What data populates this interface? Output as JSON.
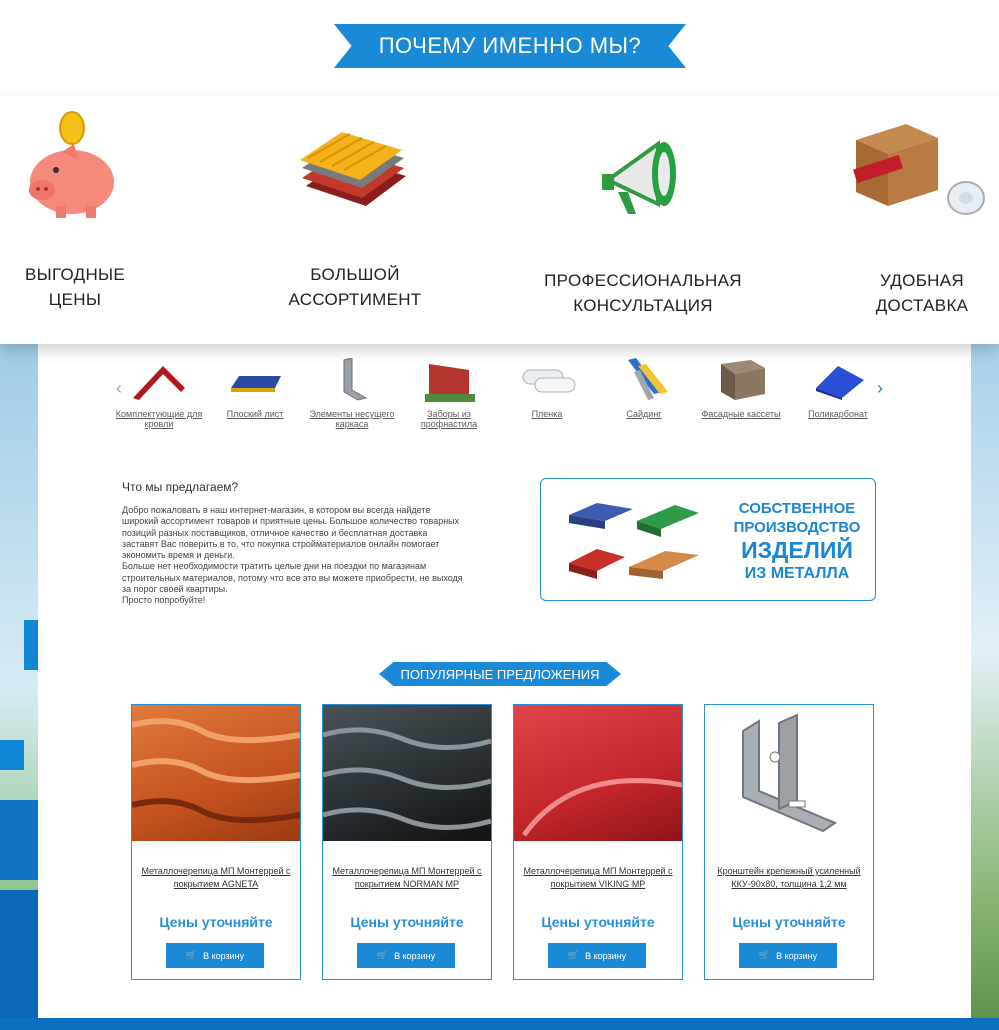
{
  "header": {
    "title": "ПОЧЕМУ ИМЕННО МЫ?"
  },
  "why": [
    {
      "l1": "ВЫГОДНЫЕ",
      "l2": "ЦЕНЫ",
      "icon": "piggy-bank-icon"
    },
    {
      "l1": "БОЛЬШОЙ",
      "l2": "АССОРТИМЕНТ",
      "icon": "metal-sheets-icon"
    },
    {
      "l1": "ПРОФЕССИОНАЛЬНАЯ",
      "l2": "КОНСУЛЬТАЦИЯ",
      "icon": "megaphone-icon"
    },
    {
      "l1": "УДОБНАЯ",
      "l2": "ДОСТАВКА",
      "icon": "delivery-box-icon"
    }
  ],
  "categories": [
    {
      "label": "Комплектующие для кровли",
      "icon": "roof-accessory-icon"
    },
    {
      "label": "Плоский лист",
      "icon": "flat-sheet-icon"
    },
    {
      "label": "Элементы несущего каркаса",
      "icon": "bracket-icon"
    },
    {
      "label": "Заборы из профнастила",
      "icon": "fence-icon"
    },
    {
      "label": "Пленка",
      "icon": "film-roll-icon"
    },
    {
      "label": "Сайдинг",
      "icon": "siding-icon"
    },
    {
      "label": "Фасадные кассеты",
      "icon": "facade-cassette-icon"
    },
    {
      "label": "Поликарбонат",
      "icon": "polycarbonate-icon"
    }
  ],
  "offer": {
    "title": "Что мы предлагаем?",
    "lines": [
      "Добро пожаловать в наш интернет-магазин, в котором вы всегда найдете",
      "широкий ассортимент товаров и приятные цены. Большое количество товарных",
      "позиций разных поставщиков, отличное качество и бесплатная доставка",
      "заставят Вас поверить в то, что покупка стройматериалов онлайн помогает",
      "экономить время и деньги.",
      "Больше нет необходимости тратить целые дни на поездки по магазинам",
      "строительных материалов, потому что все это вы можете приобрести, не выходя",
      "за порог своей квартиры.",
      "Просто попробуйте!"
    ]
  },
  "promo": {
    "l1": "СОБСТВЕННОЕ",
    "l2": "ПРОИЗВОДСТВО",
    "l3": "ИЗДЕЛИЙ",
    "l4": "ИЗ МЕТАЛЛА"
  },
  "popular": {
    "title": "ПОПУЛЯРНЫЕ ПРЕДЛОЖЕНИЯ",
    "products": [
      {
        "name": "Металлочерепица МП Монтеррей с покрытием AGNETA",
        "price": "Цены уточняйте",
        "button": "В корзину"
      },
      {
        "name": "Металлочерепица МП Монтеррей с покрытием NORMAN MP",
        "price": "Цены уточняйте",
        "button": "В корзину"
      },
      {
        "name": "Металлочерепица МП Монтеррей с покрытием VIKING MP",
        "price": "Цены уточняйте",
        "button": "В корзину"
      },
      {
        "name": "Кронштейн крепежный усиленный ККУ-90х80, толщина 1,2 мм",
        "price": "Цены уточняйте",
        "button": "В корзину"
      }
    ]
  },
  "colors": {
    "accent": "#1a8ad6",
    "border": "#2a8fd8"
  }
}
